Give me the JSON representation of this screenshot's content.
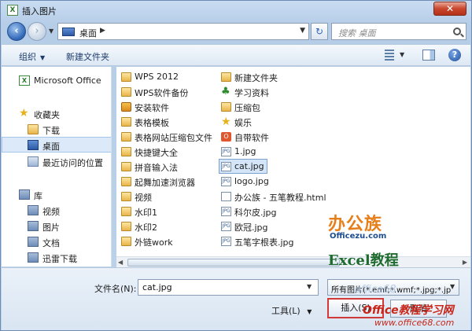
{
  "window": {
    "title": "插入图片",
    "close": "✕"
  },
  "nav": {
    "address": "桌面",
    "search_placeholder": "搜索 桌面"
  },
  "toolbar": {
    "organize": "组织",
    "new_folder": "新建文件夹",
    "help": "?"
  },
  "sidebar": {
    "items": [
      {
        "label": "Microsoft Office",
        "icon": "excel-icon"
      },
      {
        "label": "收藏夹",
        "icon": "star-icon"
      },
      {
        "label": "下载",
        "icon": "folder-icon"
      },
      {
        "label": "桌面",
        "icon": "desktop-icon"
      },
      {
        "label": "最近访问的位置",
        "icon": "recent-icon"
      },
      {
        "label": "库",
        "icon": "library-icon"
      },
      {
        "label": "视频",
        "icon": "library-icon"
      },
      {
        "label": "图片",
        "icon": "library-icon"
      },
      {
        "label": "文档",
        "icon": "library-icon"
      },
      {
        "label": "迅雷下载",
        "icon": "library-icon"
      }
    ]
  },
  "files": {
    "col1": [
      "WPS 2012",
      "WPS软件备份",
      "安装软件",
      "表格模板",
      "表格网站压缩包文件",
      "快捷键大全",
      "拼音输入法",
      "起舞加速浏览器",
      "视频",
      "水印1",
      "水印2",
      "外链work"
    ],
    "col2": [
      "新建文件夹",
      "学习资料",
      "压缩包",
      "娱乐",
      "自带软件",
      "1.jpg",
      "cat.jpg",
      "logo.jpg",
      "办公族 - 五笔教程.html",
      "科尔皮.jpg",
      "欧冠.jpg",
      "五笔字根表.jpg"
    ]
  },
  "bottom": {
    "filename_label": "文件名(N):",
    "filename_value": "cat.jpg",
    "filetype": "所有图片(*.emf;*.wmf;*.jpg;*.jp",
    "tools": "工具(L)",
    "insert": "插入(S)",
    "cancel": "取消"
  },
  "watermarks": {
    "brand": "办公族",
    "brand_sub": "Officezu.com",
    "excel": "Excel教程",
    "site_name": "Office教程学习网",
    "site_url": "www.office68.com",
    "faint": "office68"
  }
}
